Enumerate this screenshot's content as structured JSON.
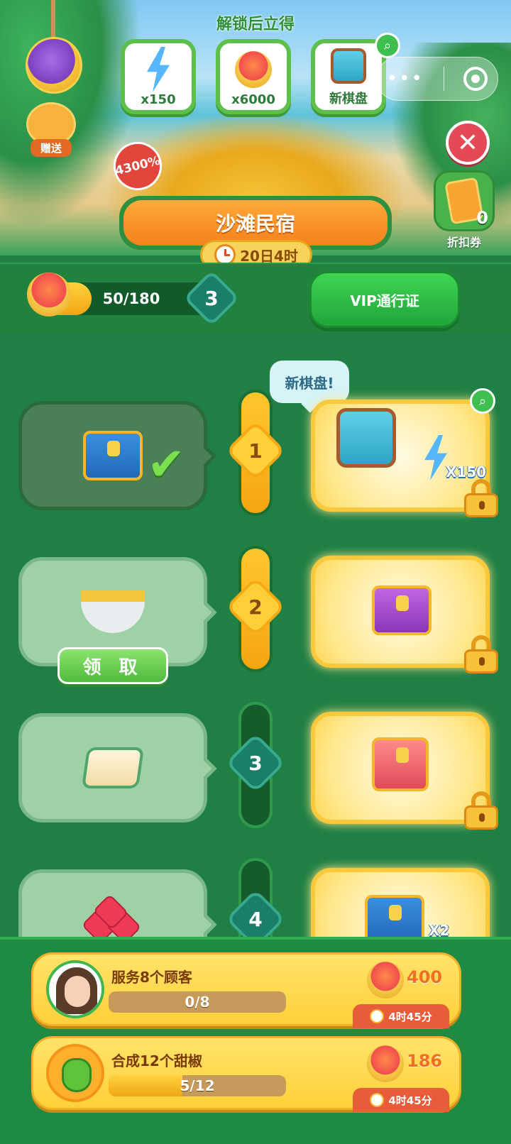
{
  "header": {
    "unlock_title": "解锁后立得",
    "rewards": [
      {
        "label": "x150",
        "icon": "energy-bolt-icon"
      },
      {
        "label": "x6000",
        "icon": "beach-umbrella-icon"
      },
      {
        "label": "新棋盘",
        "icon": "new-board-icon"
      }
    ],
    "gift_label": "赠送",
    "bonus_percent": "4300%",
    "discount_count": "0",
    "discount_label": "折扣券",
    "event_name": "沙滩民宿",
    "timer": "20日4时"
  },
  "progress": {
    "text": "50/180",
    "value": 50,
    "max": 180,
    "level": "3",
    "vip_button": "VIP通行证"
  },
  "rows": [
    {
      "level": "1",
      "free_item": "treasure-chest",
      "claimed": true,
      "vip_items": [
        "新棋盘",
        "X150"
      ]
    },
    {
      "level": "2",
      "free_item": "corn-soup",
      "claim_label": "领 取",
      "vip_item": "purple-chest"
    },
    {
      "level": "3",
      "free_item": "fried-rice",
      "vip_item": "pink-chest"
    },
    {
      "level": "4",
      "free_item": "ruby-gems",
      "vip_item": "blue-chest",
      "vip_count": "X2"
    }
  ],
  "speech_bubble": "新棋盘!",
  "tasks": [
    {
      "title": "服务8个顾客",
      "progress_text": "0/8",
      "value": 0,
      "max": 8,
      "reward": "400",
      "timer": "4时45分"
    },
    {
      "title": "合成12个甜椒",
      "progress_text": "5/12",
      "value": 5,
      "max": 12,
      "reward": "186",
      "timer": "4时45分"
    }
  ],
  "colors": {
    "background": "#1f7f44",
    "accent_gold": "#ffcf3a",
    "close_red": "#e44a55",
    "vip_green": "#20a53a"
  }
}
